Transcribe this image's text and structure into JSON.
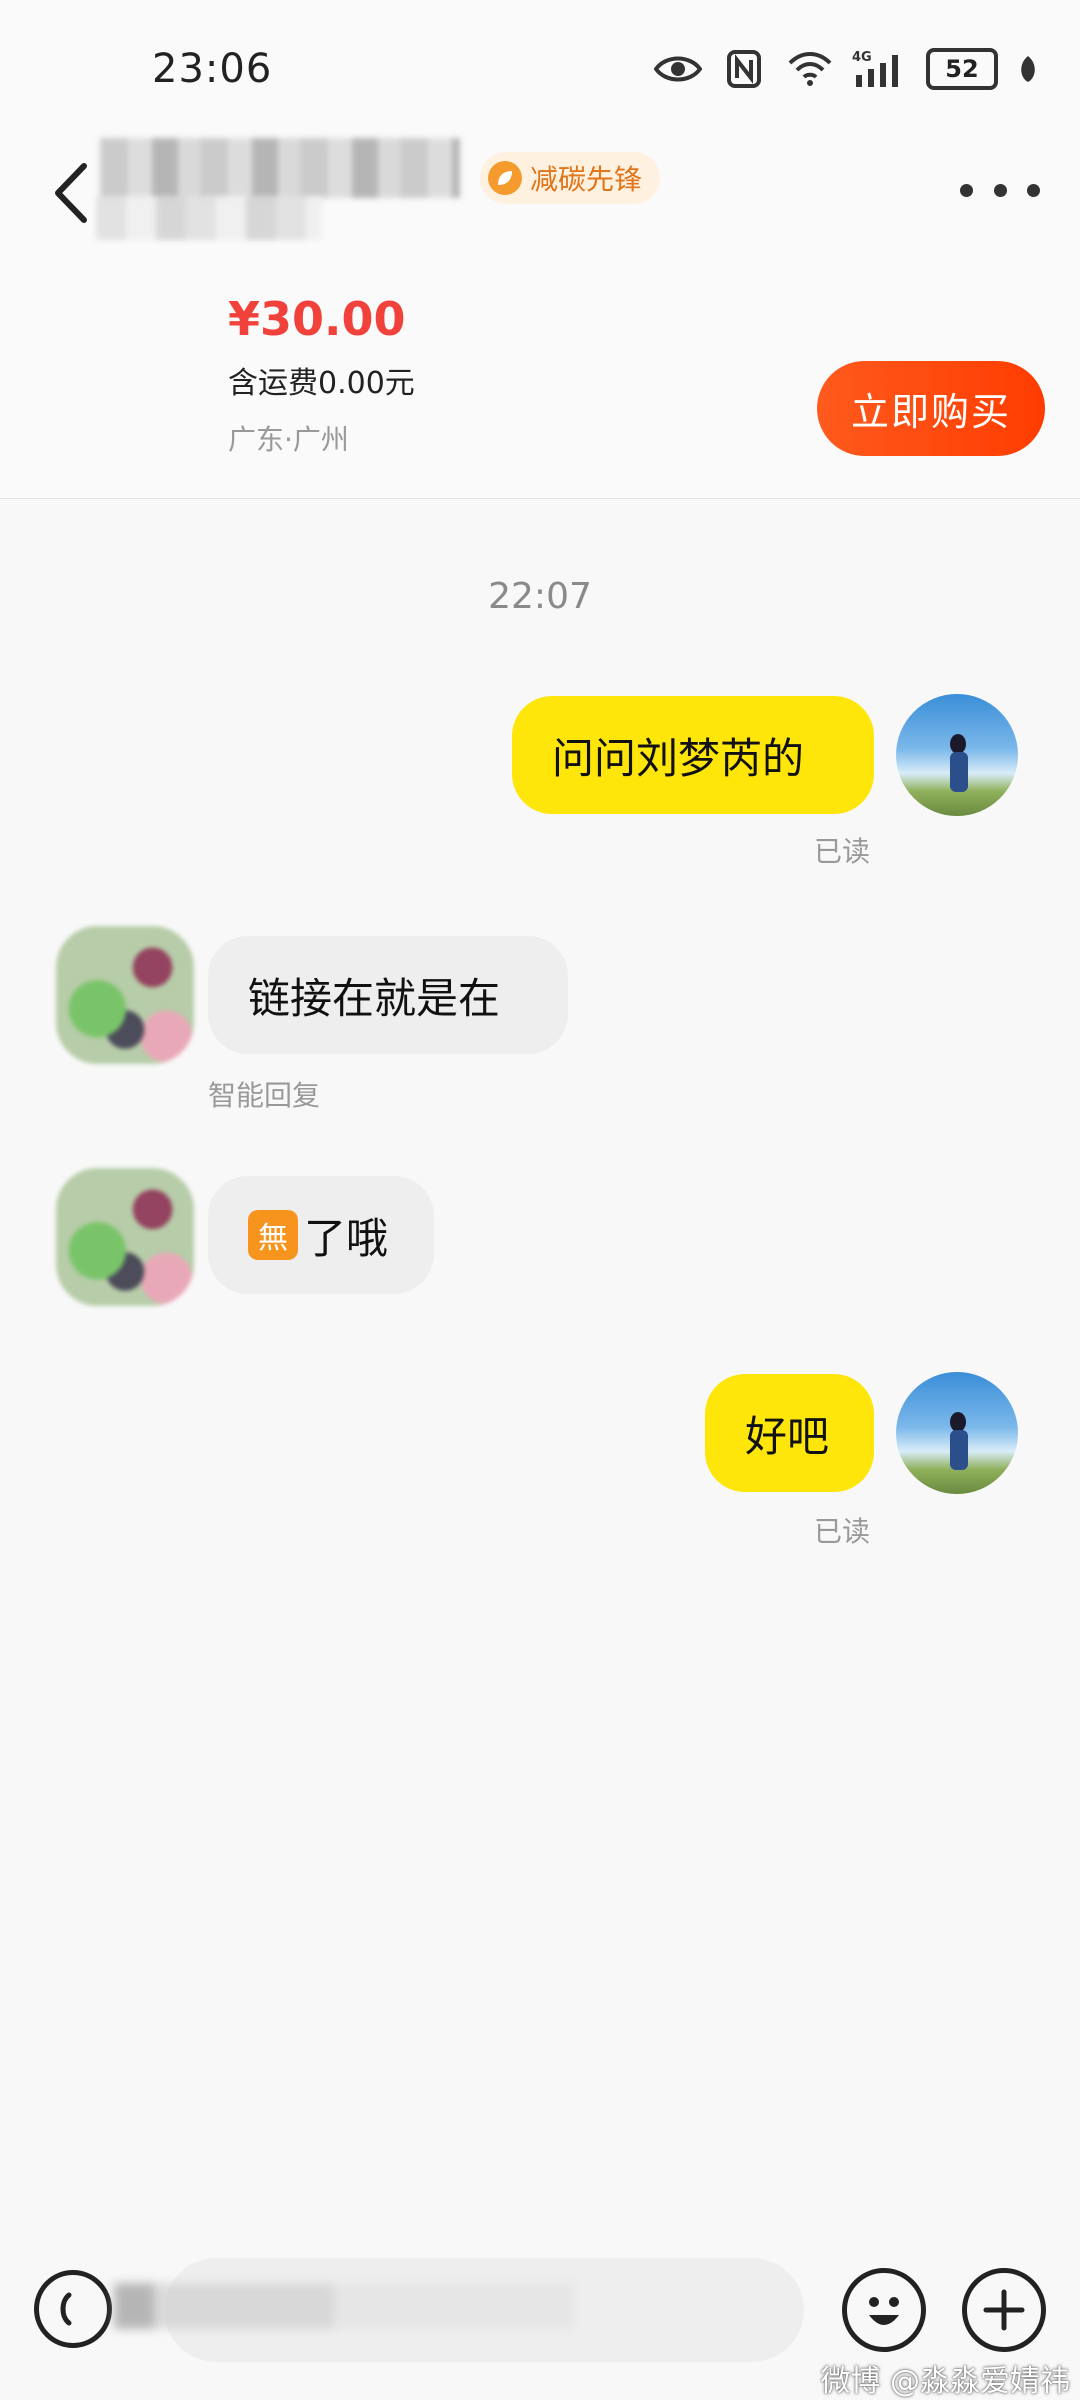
{
  "status_bar": {
    "time": "23:06",
    "network": "4G",
    "battery": "52",
    "icons": [
      "eye-icon",
      "nfc-icon",
      "wifi-icon",
      "signal-icon",
      "battery-icon",
      "leaf-icon"
    ]
  },
  "header": {
    "badge_label": "减碳先锋",
    "price": "¥30.00",
    "shipping": "含运费0.00元",
    "location": "广东·广州",
    "buy_label": "立即购买"
  },
  "chat": {
    "timestamp": "22:07",
    "messages": [
      {
        "side": "me",
        "text": "问问刘梦芮的",
        "status": "已读"
      },
      {
        "side": "other",
        "text": "链接在就是在",
        "note": "智能回复"
      },
      {
        "side": "other",
        "sticker": "無",
        "text": "了哦"
      },
      {
        "side": "me",
        "text": "好吧",
        "status": "已读"
      }
    ]
  },
  "footer": {
    "input_placeholder": ""
  },
  "watermark": "微博 @淼淼爱婧祎",
  "colors": {
    "accent_buy": "#ff4500",
    "bubble_out": "#ffe60a",
    "price": "#f0413a"
  }
}
